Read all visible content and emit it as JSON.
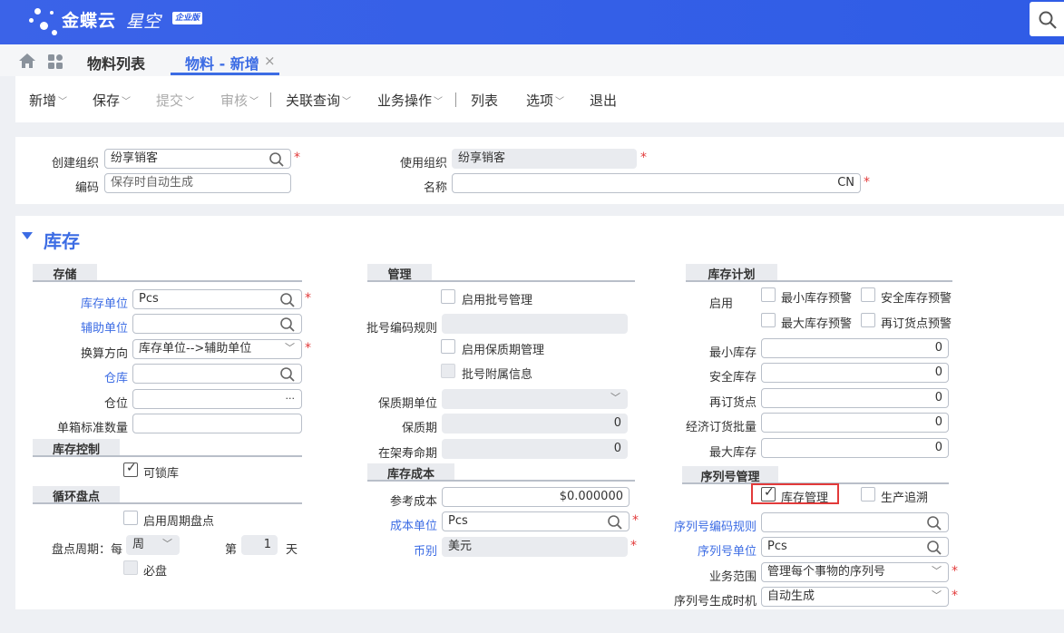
{
  "app": {
    "brand": "金蝶云",
    "product": "星空",
    "edition": "企业版"
  },
  "tabs": {
    "list": "物料列表",
    "new": "物料 - 新增",
    "close": "×"
  },
  "toolbar": {
    "add": "新增",
    "save": "保存",
    "submit": "提交",
    "audit": "审核",
    "related": "关联查询",
    "business": "业务操作",
    "list": "列表",
    "options": "选项",
    "exit": "退出"
  },
  "header": {
    "create_org_label": "创建组织",
    "create_org_value": "纷享销客",
    "use_org_label": "使用组织",
    "use_org_value": "纷享销客",
    "code_label": "编码",
    "code_placeholder": "保存时自动生成",
    "name_label": "名称",
    "name_lang": "CN"
  },
  "section": {
    "title": "库存"
  },
  "storage": {
    "title": "存储",
    "stock_unit_label": "库存单位",
    "stock_unit_value": "Pcs",
    "aux_unit_label": "辅助单位",
    "aux_unit_value": "",
    "conv_dir_label": "换算方向",
    "conv_dir_value": "库存单位-->辅助单位",
    "warehouse_label": "仓库",
    "warehouse_value": "",
    "location_label": "仓位",
    "location_value": "",
    "location_btn": "···",
    "box_qty_label": "单箱标准数量",
    "box_qty_value": ""
  },
  "stock_control": {
    "title": "库存控制",
    "lockable_label": "可锁库",
    "lockable_checked": true
  },
  "cycle_count": {
    "title": "循环盘点",
    "enable_label": "启用周期盘点",
    "period_label": "盘点周期：每",
    "period_value": "周",
    "nth_label": "第",
    "nth_value": "1",
    "day_label": "天",
    "must_label": "必盘"
  },
  "management": {
    "title": "管理",
    "batch_label": "启用批号管理",
    "batch_rule_label": "批号编码规则",
    "shelf_label": "启用保质期管理",
    "batch_attach_label": "批号附属信息",
    "shelf_unit_label": "保质期单位",
    "shelf_period_label": "保质期",
    "shelf_period_value": "0",
    "shelf_life_label": "在架寿命期",
    "shelf_life_value": "0"
  },
  "stock_cost": {
    "title": "库存成本",
    "ref_cost_label": "参考成本",
    "ref_cost_value": "$0.000000",
    "cost_unit_label": "成本单位",
    "cost_unit_value": "Pcs",
    "currency_label": "币别",
    "currency_value": "美元"
  },
  "stock_plan": {
    "title": "库存计划",
    "enable_label": "启用",
    "min_warn": "最小库存预警",
    "safe_warn": "安全库存预警",
    "max_warn": "最大库存预警",
    "reorder_warn": "再订货点预警",
    "min_stock_label": "最小库存",
    "min_stock_value": "0",
    "safe_stock_label": "安全库存",
    "safe_stock_value": "0",
    "reorder_label": "再订货点",
    "reorder_value": "0",
    "eoq_label": "经济订货批量",
    "eoq_value": "0",
    "max_stock_label": "最大库存",
    "max_stock_value": "0"
  },
  "serial": {
    "title": "序列号管理",
    "stock_mgmt_label": "库存管理",
    "stock_mgmt_checked": true,
    "trace_label": "生产追溯",
    "rule_label": "序列号编码规则",
    "rule_value": "",
    "unit_label": "序列号单位",
    "unit_value": "Pcs",
    "scope_label": "业务范围",
    "scope_value": "管理每个事物的序列号",
    "gen_label": "序列号生成时机",
    "gen_value": "自动生成"
  },
  "colors": {
    "brand_blue": "#2f5ce6",
    "link_blue": "#3c6ce4",
    "required_red": "#e23a3a"
  }
}
